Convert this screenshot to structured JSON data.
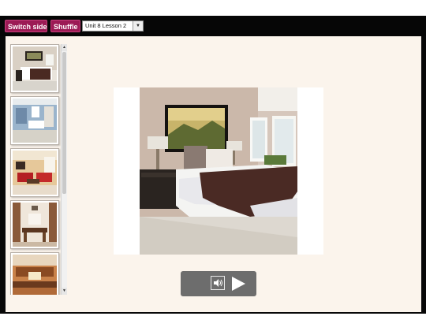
{
  "toolbar": {
    "switch_side_label": "Switch side",
    "shuffle_label": "Shuffle",
    "lesson_select": {
      "selected": "Unit 8 Lesson 2"
    }
  },
  "thumbnails": [
    {
      "icon": "bedroom-photo-thumbnail-icon"
    },
    {
      "icon": "bathroom-photo-thumbnail-icon"
    },
    {
      "icon": "living-room-photo-thumbnail-icon"
    },
    {
      "icon": "dining-room-photo-thumbnail-icon"
    },
    {
      "icon": "kitchen-photo-thumbnail-icon"
    }
  ],
  "flashcard": {
    "icon": "bedroom-photo-icon"
  },
  "player": {
    "sound_icon": "speaker-icon",
    "play_icon": "play-icon"
  },
  "colors": {
    "accent": "#9c1a55",
    "frame": "#080808",
    "content_bg": "#fbf4ec",
    "player_bg": "#6d6d6d"
  }
}
